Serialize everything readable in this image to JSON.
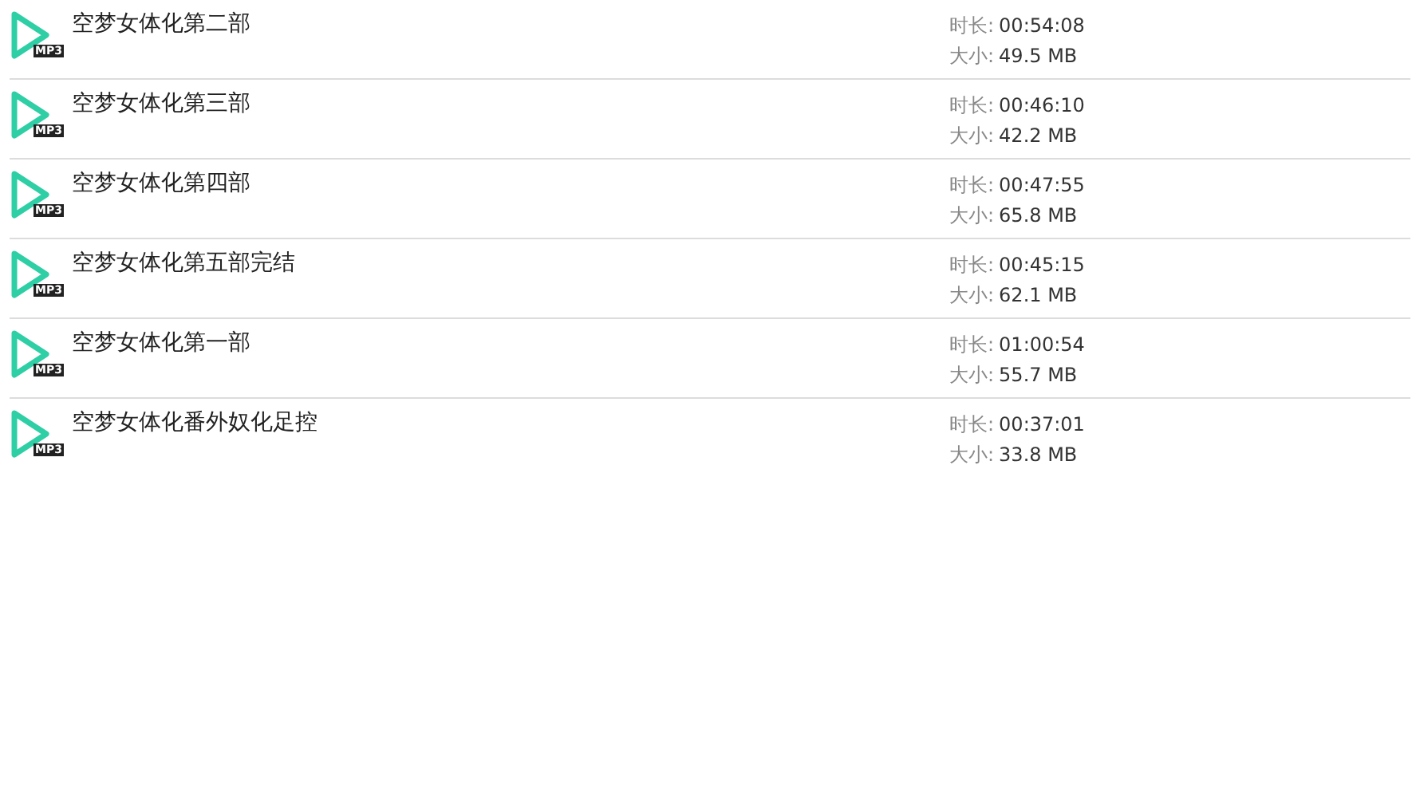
{
  "files": [
    {
      "title": "空梦女体化第二部",
      "badge": "MP3",
      "duration_label": "时长:",
      "duration": "00:54:08",
      "size_label": "大小:",
      "size": "49.5 MB"
    },
    {
      "title": "空梦女体化第三部",
      "badge": "MP3",
      "duration_label": "时长:",
      "duration": "00:46:10",
      "size_label": "大小:",
      "size": "42.2 MB"
    },
    {
      "title": "空梦女体化第四部",
      "badge": "MP3",
      "duration_label": "时长:",
      "duration": "00:47:55",
      "size_label": "大小:",
      "size": "65.8 MB"
    },
    {
      "title": "空梦女体化第五部完结",
      "badge": "MP3",
      "duration_label": "时长:",
      "duration": "00:45:15",
      "size_label": "大小:",
      "size": "62.1 MB"
    },
    {
      "title": "空梦女体化第一部",
      "badge": "MP3",
      "duration_label": "时长:",
      "duration": "01:00:54",
      "size_label": "大小:",
      "size": "55.7 MB"
    },
    {
      "title": "空梦女体化番外奴化足控",
      "badge": "MP3",
      "duration_label": "时长:",
      "duration": "00:37:01",
      "size_label": "大小:",
      "size": "33.8 MB"
    }
  ]
}
